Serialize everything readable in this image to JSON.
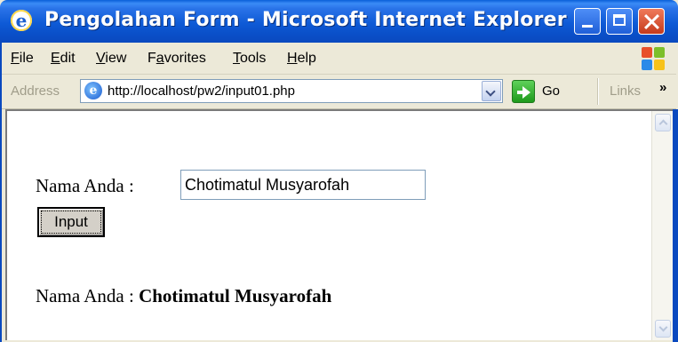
{
  "window": {
    "title": "Pengolahan Form - Microsoft Internet Explorer",
    "icon": "ie-page-icon"
  },
  "menu": {
    "items": [
      {
        "label": "File",
        "underline": "F",
        "rest": "ile"
      },
      {
        "label": "Edit",
        "underline": "E",
        "rest": "dit"
      },
      {
        "label": "View",
        "underline": "V",
        "rest": "iew"
      },
      {
        "label": "Favorites",
        "pre": "F",
        "underline": "a",
        "rest": "vorites"
      },
      {
        "label": "Tools",
        "underline": "T",
        "rest": "ools"
      },
      {
        "label": "Help",
        "underline": "H",
        "rest": "elp"
      }
    ]
  },
  "address_bar": {
    "label": "Address",
    "url": "http://localhost/pw2/input01.php",
    "go_label": "Go",
    "links_label": "Links",
    "more": "»"
  },
  "form": {
    "label": "Nama Anda :",
    "input_value": "Chotimatul Musyarofah",
    "button_label": "Input"
  },
  "result": {
    "prefix": "Nama Anda :",
    "value": "Chotimatul Musyarofah"
  },
  "colors": {
    "title_bar": "#0a49bf",
    "chrome": "#ece9d8",
    "close_button": "#c53a1c"
  }
}
